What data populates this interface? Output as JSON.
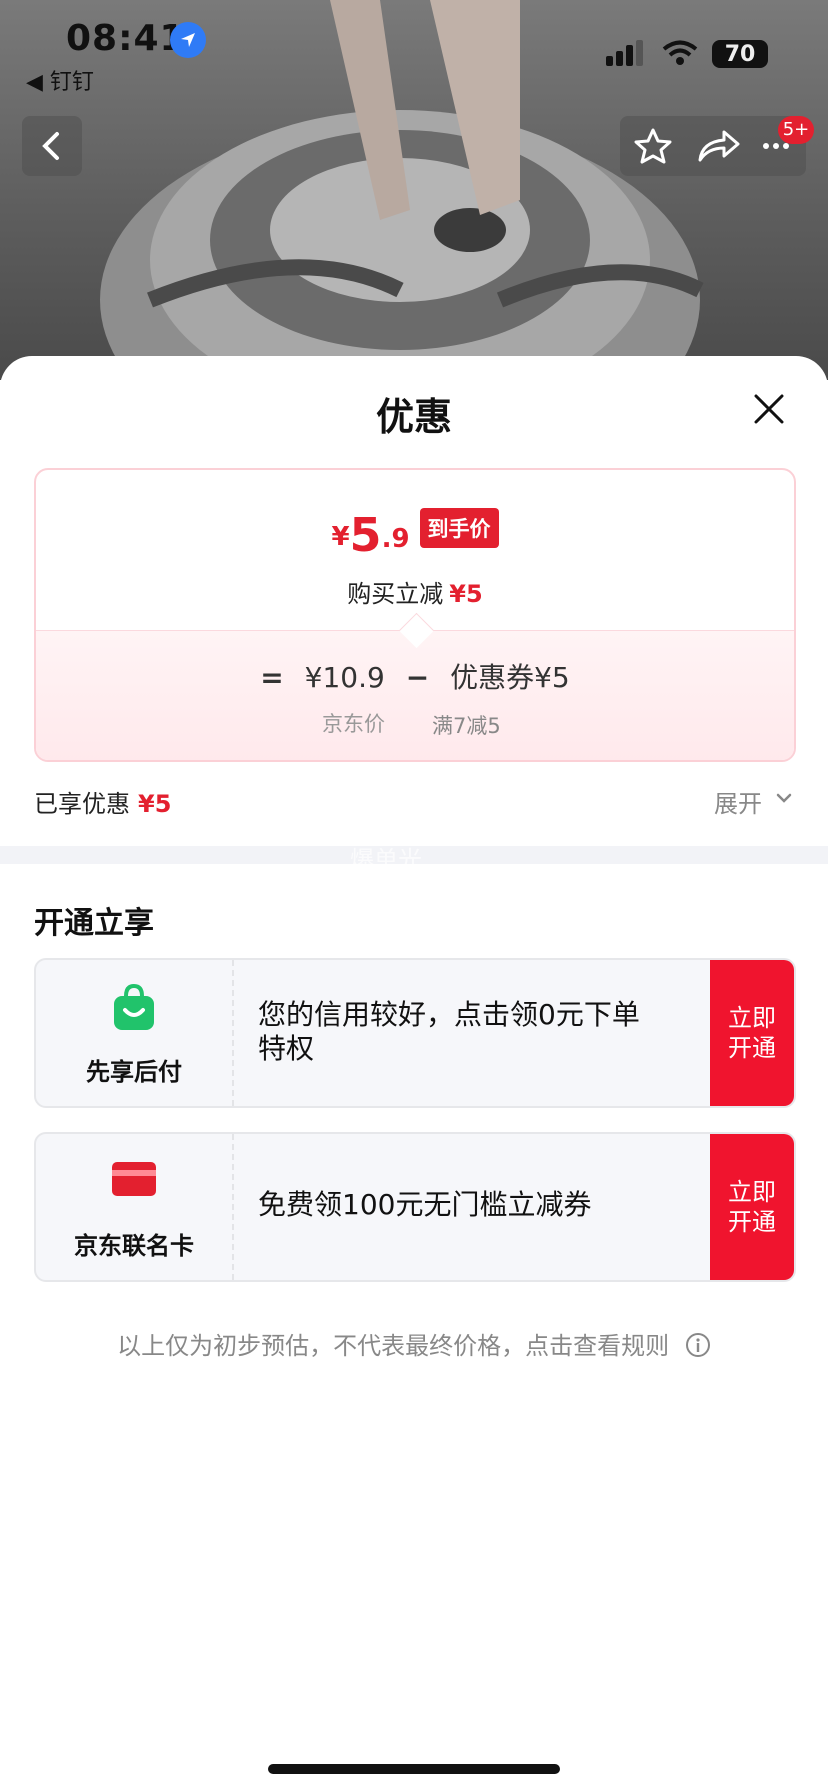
{
  "status": {
    "time": "08:41",
    "back_app": "◀ 钉钉",
    "battery": "70"
  },
  "nav": {
    "badge": "5+"
  },
  "sheet": {
    "title": "优惠"
  },
  "price_card": {
    "currency": "¥",
    "price_int": "5",
    "price_dec": ".9",
    "tag": "到手价",
    "save_label": "购买立减",
    "save_value": "¥5",
    "eq": "=",
    "jd_price": "¥10.9",
    "minus": "−",
    "coupon_label": "优惠券",
    "coupon_value": "¥5",
    "jd_price_label": "京东价",
    "coupon_rule": "满7减5"
  },
  "enjoyed": {
    "label": "已享优惠",
    "value": "¥5",
    "expand": "展开"
  },
  "watermark": "爆单光",
  "section": {
    "title": "开通立享"
  },
  "promos": [
    {
      "label": "先享后付",
      "desc": "您的信用较好，点击领0元下单特权",
      "button": "立即开通",
      "icon": "shopping-bag-icon",
      "color": "#21c36b"
    },
    {
      "label": "京东联名卡",
      "desc": "免费领100元无门槛立减券",
      "button": "立即开通",
      "icon": "credit-card-icon",
      "color": "#e3202f"
    }
  ],
  "note": "以上仅为初步预估，不代表最终价格，点击查看规则"
}
